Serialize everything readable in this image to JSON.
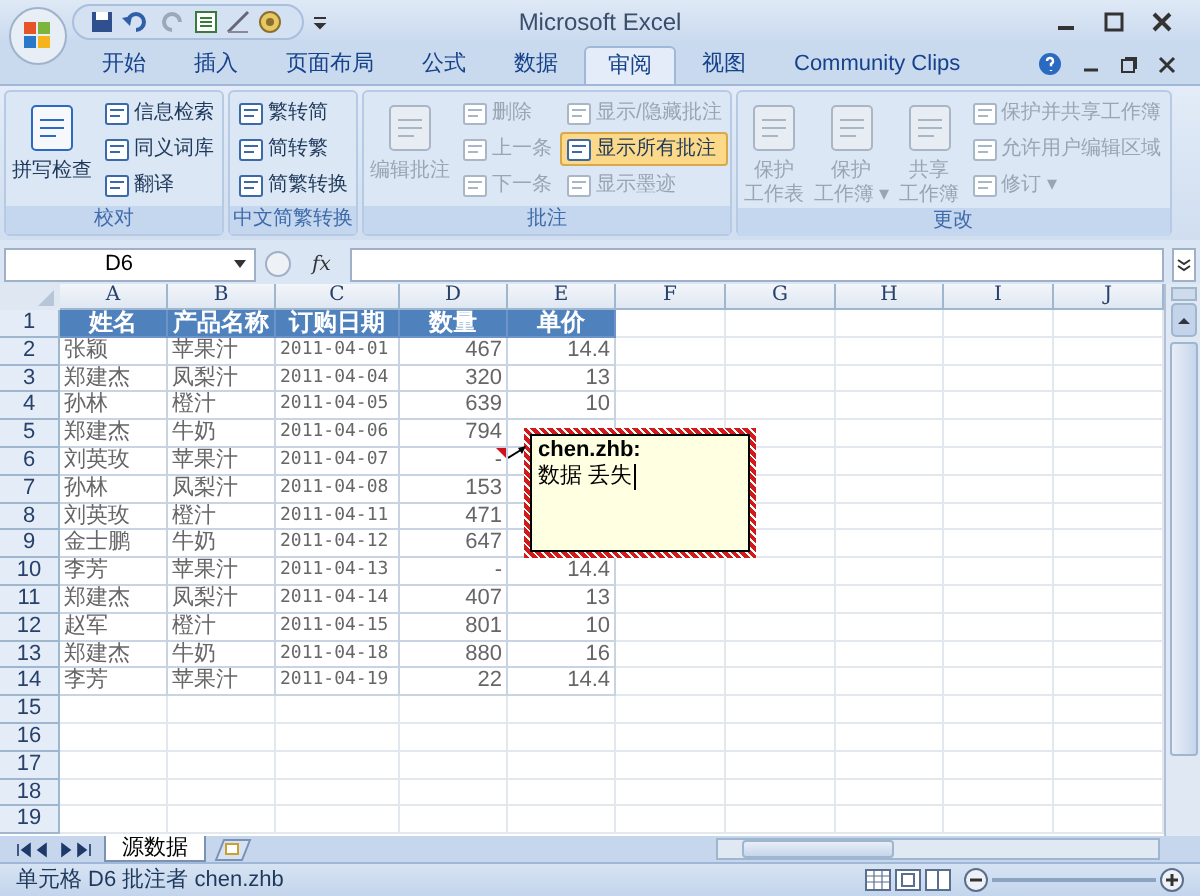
{
  "window": {
    "title": "Microsoft Excel"
  },
  "ribbon_tabs": [
    {
      "label": "开始",
      "selected": false
    },
    {
      "label": "插入",
      "selected": false
    },
    {
      "label": "页面布局",
      "selected": false
    },
    {
      "label": "公式",
      "selected": false
    },
    {
      "label": "数据",
      "selected": false
    },
    {
      "label": "审阅",
      "selected": true
    },
    {
      "label": "视图",
      "selected": false
    },
    {
      "label": "Community Clips",
      "selected": false
    }
  ],
  "ribbon_groups": [
    {
      "label": "校对",
      "columns": [
        {
          "kind": "large",
          "lines": [
            "拼写检查"
          ],
          "disabled": false
        },
        {
          "kind": "stack",
          "items": [
            {
              "label": "信息检索",
              "disabled": false,
              "selected": false
            },
            {
              "label": "同义词库",
              "disabled": false,
              "selected": false
            },
            {
              "label": "翻译",
              "disabled": false,
              "selected": false
            }
          ]
        }
      ]
    },
    {
      "label": "中文简繁转换",
      "columns": [
        {
          "kind": "stack",
          "items": [
            {
              "label": "繁转简",
              "disabled": false,
              "selected": false
            },
            {
              "label": "简转繁",
              "disabled": false,
              "selected": false
            },
            {
              "label": "简繁转换",
              "disabled": false,
              "selected": false
            }
          ]
        }
      ]
    },
    {
      "label": "批注",
      "columns": [
        {
          "kind": "large",
          "lines": [
            "编辑批注"
          ],
          "disabled": true
        },
        {
          "kind": "stack",
          "items": [
            {
              "label": "删除",
              "disabled": true,
              "selected": false
            },
            {
              "label": "上一条",
              "disabled": true,
              "selected": false
            },
            {
              "label": "下一条",
              "disabled": true,
              "selected": false
            }
          ]
        },
        {
          "kind": "stack",
          "items": [
            {
              "label": "显示/隐藏批注",
              "disabled": true,
              "selected": false
            },
            {
              "label": "显示所有批注",
              "disabled": false,
              "selected": true
            },
            {
              "label": "显示墨迹",
              "disabled": true,
              "selected": false
            }
          ]
        }
      ]
    },
    {
      "label": "更改",
      "columns": [
        {
          "kind": "large",
          "lines": [
            "保护",
            "工作表"
          ],
          "disabled": true
        },
        {
          "kind": "large",
          "lines": [
            "保护",
            "工作簿 ▾"
          ],
          "disabled": true
        },
        {
          "kind": "large",
          "lines": [
            "共享",
            "工作簿"
          ],
          "disabled": true
        },
        {
          "kind": "stack",
          "items": [
            {
              "label": "保护并共享工作簿",
              "disabled": true,
              "selected": false
            },
            {
              "label": "允许用户编辑区域",
              "disabled": true,
              "selected": false
            },
            {
              "label": "修订 ▾",
              "disabled": true,
              "selected": false
            }
          ]
        }
      ]
    }
  ],
  "formula_bar": {
    "name_box": "D6",
    "formula_icon": "fx"
  },
  "sheet": {
    "columns": [
      "A",
      "B",
      "C",
      "D",
      "E",
      "F",
      "G",
      "H",
      "I",
      "J"
    ],
    "row_numbers": [
      "1",
      "2",
      "3",
      "4",
      "5",
      "6",
      "7",
      "8",
      "9",
      "10",
      "11",
      "12",
      "13",
      "14",
      "15",
      "16",
      "17",
      "18",
      "19"
    ],
    "header": [
      "姓名",
      "产品名称",
      "订购日期",
      "数量",
      "单价"
    ],
    "rows": [
      [
        "张颖",
        "苹果汁",
        "2011-04-01",
        "467",
        "14.4"
      ],
      [
        "郑建杰",
        "凤梨汁",
        "2011-04-04",
        "320",
        "13"
      ],
      [
        "孙林",
        "橙汁",
        "2011-04-05",
        "639",
        "10"
      ],
      [
        "郑建杰",
        "牛奶",
        "2011-04-06",
        "794"
      ],
      [
        "刘英玫",
        "苹果汁",
        "2011-04-07",
        "-"
      ],
      [
        "孙林",
        "凤梨汁",
        "2011-04-08",
        "153"
      ],
      [
        "刘英玫",
        "橙汁",
        "2011-04-11",
        "471"
      ],
      [
        "金士鹏",
        "牛奶",
        "2011-04-12",
        "647"
      ],
      [
        "李芳",
        "苹果汁",
        "2011-04-13",
        "-",
        "14.4"
      ],
      [
        "郑建杰",
        "凤梨汁",
        "2011-04-14",
        "407",
        "13"
      ],
      [
        "赵军",
        "橙汁",
        "2011-04-15",
        "801",
        "10"
      ],
      [
        "郑建杰",
        "牛奶",
        "2011-04-18",
        "880",
        "16"
      ],
      [
        "李芳",
        "苹果汁",
        "2011-04-19",
        "22",
        "14.4"
      ]
    ],
    "comment": {
      "author": "chen.zhb:",
      "text": "数据 丢失"
    }
  },
  "sheet_tabs": [
    {
      "label": "源数据",
      "selected": true
    }
  ],
  "status_bar": {
    "text": "单元格 D6 批注者 chen.zhb"
  }
}
